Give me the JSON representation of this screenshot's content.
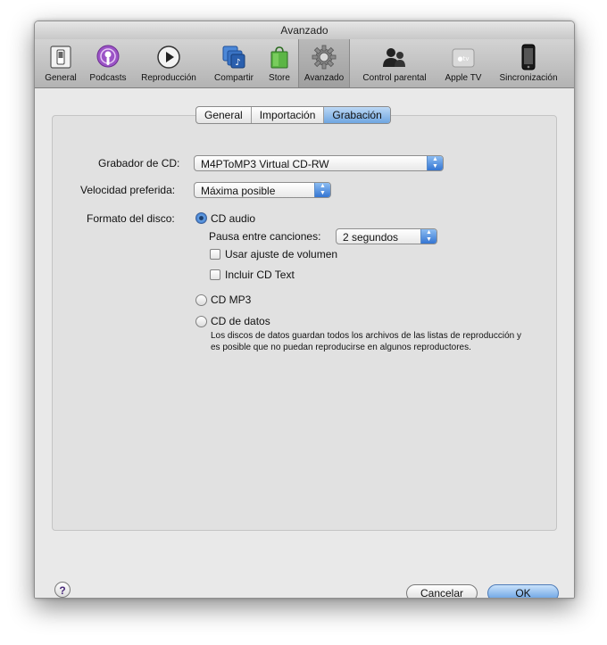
{
  "window": {
    "title": "Avanzado"
  },
  "toolbar": {
    "items": [
      {
        "label": "General",
        "icon": "switch-icon"
      },
      {
        "label": "Podcasts",
        "icon": "podcast-icon"
      },
      {
        "label": "Reproducción",
        "icon": "play-icon"
      },
      {
        "label": "Compartir",
        "icon": "share-icon"
      },
      {
        "label": "Store",
        "icon": "store-bag-icon"
      },
      {
        "label": "Avanzado",
        "icon": "gear-icon",
        "selected": true
      },
      {
        "label": "Control parental",
        "icon": "parental-icon"
      },
      {
        "label": "Apple TV",
        "icon": "apple-tv-icon"
      },
      {
        "label": "Sincronización",
        "icon": "iphone-icon"
      }
    ]
  },
  "tabs": [
    {
      "label": "General"
    },
    {
      "label": "Importación"
    },
    {
      "label": "Grabación",
      "active": true
    }
  ],
  "burner": {
    "label": "Grabador de CD:",
    "value": "M4PToMP3 Virtual CD-RW"
  },
  "speed": {
    "label": "Velocidad preferida:",
    "value": "Máxima posible"
  },
  "format": {
    "label": "Formato del disco:",
    "cd_audio": {
      "label": "CD audio",
      "selected": true
    },
    "gap": {
      "label": "Pausa entre canciones:",
      "value": "2 segundos"
    },
    "sound_check": {
      "label": "Usar ajuste de volumen",
      "checked": false
    },
    "cd_text": {
      "label": "Incluir CD Text",
      "checked": false
    },
    "cd_mp3": {
      "label": "CD MP3",
      "selected": false
    },
    "data_cd": {
      "label": "CD de datos",
      "selected": false
    },
    "description": "Los discos de datos guardan todos los archivos de las listas de reproducción y es posible que no puedan reproducirse en algunos reproductores."
  },
  "buttons": {
    "help": "?",
    "cancel": "Cancelar",
    "ok": "OK"
  },
  "colors": {
    "accent": "#3475d2",
    "window_bg": "#e8e8e8"
  }
}
